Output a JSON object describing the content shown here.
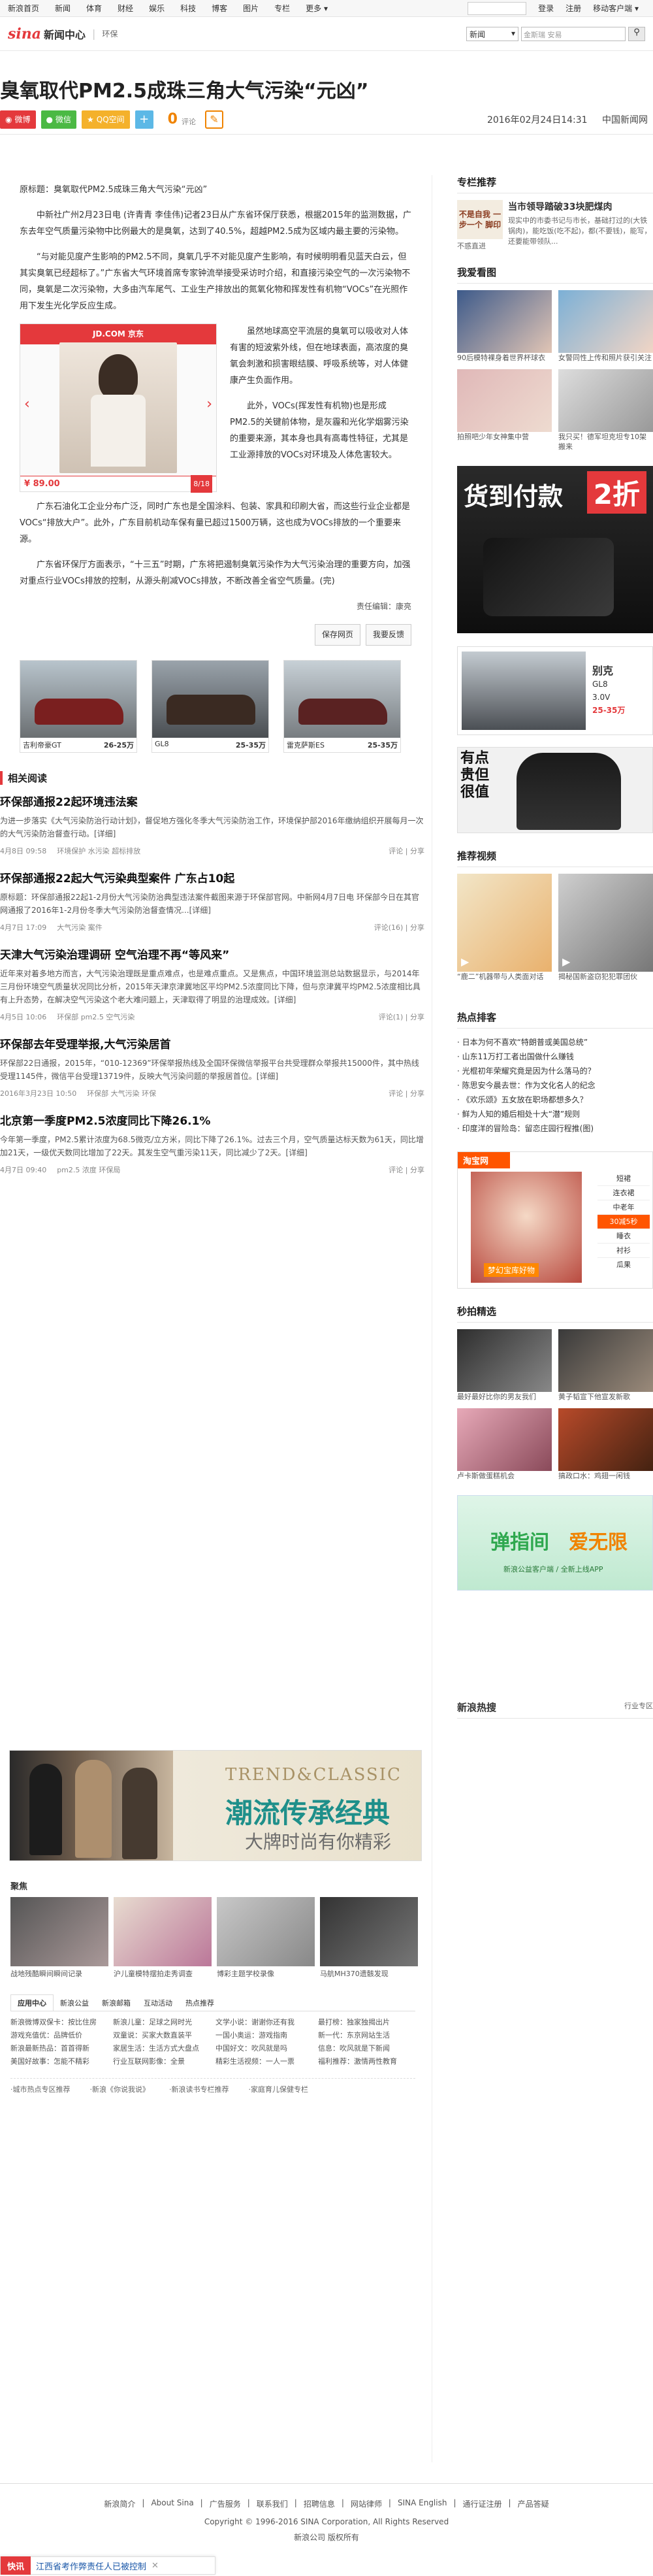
{
  "topnav": {
    "items": [
      "新浪首页",
      "新闻",
      "体育",
      "财经",
      "娱乐",
      "科技",
      "博客",
      "图片",
      "专栏",
      "更多"
    ],
    "search_placeholder": "",
    "login": "登录",
    "register": "注册",
    "mobile": "移动客户端"
  },
  "header": {
    "logo": "sina",
    "logo_sub": "新闻中心",
    "channel": "环保",
    "search_select": "新闻",
    "search_placeholder": "金斯瑞 安易",
    "search_icon": "search-icon"
  },
  "article": {
    "title": "臭氧取代PM2.5成珠三角大气污染“元凶”",
    "share": [
      "微博",
      "微信",
      "QQ空间"
    ],
    "comment_count": "0",
    "comment_label": "评论",
    "datetime": "2016年02月24日14:31",
    "source": "中国新闻网",
    "paragraphs": [
      "原标题：臭氧取代PM2.5成珠三角大气污染“元凶”",
      "中新社广州2月23日电 (许青青 李佳伟)记者23日从广东省环保厅获悉，根据2015年的监测数据，广东去年空气质量污染物中比例最大的是臭氧，达到了40.5%，超越PM2.5成为区域内最主要的污染物。",
      "“与对能见度产生影响的PM2.5不同，臭氧几乎不对能见度产生影响，有时候明明看见蓝天白云，但其实臭氧已经超标了。”广东省大气环境首席专家钟流举接受采访时介绍，和直接污染空气的一次污染物不同，臭氧是二次污染物，大多由汽车尾气、工业生产排放出的氮氧化物和挥发性有机物“VOCs”在光照作用下发生光化学反应生成。",
      "虽然地球高空平流层的臭氧可以吸收对人体有害的短波紫外线，但在地球表面，高浓度的臭氧会刺激和损害眼结膜、呼吸系统等，对人体健康产生负面作用。",
      "此外，VOCs(挥发性有机物)也是形成PM2.5的关键前体物，是灰霾和光化学烟雾污染的重要来源，其本身也具有高毒性特征，尤其是工业源排放的VOCs对环境及人体危害较大。",
      "广东石油化工企业分布广泛，同时广东也是全国涂料、包装、家具和印刷大省，而这些行业企业都是VOCs“排放大户”。此外，广东目前机动车保有量已超过1500万辆，这也成为VOCs排放的一个重要来源。",
      "广东省环保厅方面表示，“十三五”时期，广东将把遏制臭氧污染作为大气污染治理的重要方向，加强对重点行业VOCs排放的控制，从源头削减VOCs排放，不断改善全省空气质量。(完)"
    ],
    "editor_label": "责任编辑：",
    "editor": "康亮",
    "save_btn": "保存网页",
    "report_btn": "我要反馈"
  },
  "gallery": {
    "tag": "JD.COM 京东",
    "price": "¥ 89.00",
    "page": "8/18"
  },
  "car_row": [
    {
      "name": "吉利帝豪GT"
    },
    {
      "name": "GL8"
    },
    {
      "name": "雷克萨斯ES"
    }
  ],
  "car_prices": [
    "26-25万",
    "25-35万",
    "25-35万"
  ],
  "related": {
    "title": "相关阅读",
    "items": [
      {
        "title": "环保部通报22起环境违法案",
        "summary": "为进一步落实《大气污染防治行动计划》，督促地方强化冬季大气污染防治工作，环境保护部2016年缴纳组织开展每月一次的大气污染防治督查行动。[详细]",
        "date": "4月8日 09:58",
        "tags": "环境保护 水污染 超标排放",
        "actions": "评论 | 分享"
      },
      {
        "title": "环保部通报22起大气污染典型案件 广东占10起",
        "summary": "原标题：环保部通报22起1-2月份大气污染防治典型违法案件截图来源于环保部官网。中新网4月7日电 环保部今日在其官网通报了2016年1-2月份冬季大气污染防治督查情况...[详细]",
        "date": "4月7日 17:09",
        "tags": "大气污染 案件",
        "actions": "评论(16) | 分享"
      },
      {
        "title": "天津大气污染治理调研 空气治理不再“等风来”",
        "summary": "近年来对着多地方而言，大气污染治理既是重点难点，也是难点重点。又是焦点，中国环境监测总站数据显示，与2014年三月份环境空气质量状况同比分析，2015年天津京津冀地区平均PM2.5浓度同比下降，但与京津冀平均PM2.5浓度相比具有上升态势，在解决空气污染这个老大难问题上，天津取得了明显的治理成效。[详细]",
        "date": "4月5日 10:06",
        "tags": "环保部 pm2.5 空气污染",
        "actions": "评论(1) | 分享"
      },
      {
        "title": "环保部去年受理举报,大气污染居首",
        "summary": "环保部22日通报，2015年，“010-12369”环保举报热线及全国环保微信举报平台共受理群众举报共15000件，其中热线受理1145件，微信平台受理13719件，反映大气污染问题的举报居首位。[详细]",
        "date": "2016年3月23日 10:50",
        "tags": "环保部 大气污染 环保",
        "actions": "评论 | 分享"
      },
      {
        "title": "北京第一季度PM2.5浓度同比下降26.1%",
        "summary": "今年第一季度，PM2.5累计浓度为68.5微克/立方米，同比下降了26.1%。过去三个月，空气质量达标天数为61天，同比增加21天，一级优天数同比增加了22天。其发生空气重污染11天，同比减少了2天。[详细]",
        "date": "4月7日 09:40",
        "tags": "pm2.5 浓度 环保局",
        "actions": "评论 | 分享"
      }
    ]
  },
  "trend_ad": {
    "line1": "TREND&CLASSIC",
    "line2": "潮流传承经典",
    "line3": "大牌时尚有你精彩"
  },
  "focus": {
    "title": "聚焦",
    "items": [
      "战地残酷瞬间瞬间记录",
      "沪儿童模特摆拍走秀调查",
      "博彩主题学校录像",
      "马航MH370遗骸发现"
    ]
  },
  "tabs": {
    "labels": [
      "应用中心",
      "新浪公益",
      "新浪邮箱",
      "互动活动",
      "热点推荐"
    ],
    "links": [
      [
        "新浪微博双保卡：按比住房",
        "游戏充值优：品牌低价",
        "新浪最新热品：首首得新",
        "美国好故事：怎能不精彩"
      ],
      [
        "新浪儿童：足球之网时光",
        "双童说：买家大数直装平",
        "家居生活：生活方式大盘点",
        "行业互联网影像：全景"
      ],
      [
        "文学小说：谢谢你还有我",
        "一国小奥运：游戏指南",
        "中国好文：吹风就是吗",
        "精彩生活视频：一人一票"
      ],
      [
        "最打榜：独家独揭出片",
        "新一代：东京网站生活",
        "信息：吹风就是下新闻",
        "福利推荐：激情两性教育"
      ]
    ],
    "footer_links": [
      "·城市热点专区推荐",
      "·新浪《你说我说》",
      "·新浪读书专栏推荐",
      "·家庭育儿保健专栏"
    ]
  },
  "sidebar": {
    "recommend_title": "专栏推荐",
    "recommend_item_title": "当市领导踏破33块肥煤肉",
    "recommend_item_desc": "现实中的市委书记与市长，基础打过的(大铁锅肉)，能吃饭(吃不起)，都(不要钱)，能写，还要能带领队...",
    "recommend_img_text": "不是自我 一步一个 脚印",
    "recommend_img_caption": "不惑直进",
    "love_title": "我爱看图",
    "love_items": [
      {
        "caption": "90后模特裸身着世界杯球衣"
      },
      {
        "caption": "女警同性上传和照片获引关注"
      },
      {
        "caption": "拍照吧少年女神集中营"
      },
      {
        "caption": "我只买！德军坦克坦专10架搬来"
      }
    ],
    "pay_ad": {
      "text": "货到付款",
      "discount": "2折"
    },
    "car_ad": {
      "name": "别克",
      "model": "GL8",
      "spec": "3.0V",
      "price": "25-35万"
    },
    "shirt_ad": {
      "text": "有点贵但很值"
    },
    "video_title": "推荐视频",
    "video_items": [
      {
        "caption": "“鹿二”机器带与人类面对话"
      },
      {
        "caption": "揭秘国新盗窃犯犯罪团伙"
      }
    ],
    "hot_title": "热点排客",
    "hot_list": [
      "日本为何不喜欢“特朗普或美国总统”",
      "山东11万打工者出国做什么赚钱",
      "光棍初年荣耀究竟是因为什么落马的？",
      "陈思安今晨去世：作为文化名人的纪念",
      "《欢乐颂》五女放在职场都想多久？",
      "鲜为人知的婚后相处十大“潜”规则",
      "印度洋的冒险岛：留恋庄园行程推(图)"
    ],
    "taobao_title": "淘宝网",
    "taobao_tags": [
      "短裙",
      "连衣裙",
      "中老年",
      "30减5秒",
      "睡衣",
      "衬衫",
      "瓜果"
    ],
    "taobao_banner": "梦幻宝库好物",
    "second_title": "秒拍精选",
    "second_items": [
      {
        "caption": "最好最好比你的男友我们"
      },
      {
        "caption": "黄子韬宣下他宣发新歌"
      },
      {
        "caption": "卢卡斯做蛋糕机会"
      },
      {
        "caption": "搞政口水：鸡翅一闲钱"
      }
    ],
    "app_text1": "弹指间",
    "app_text2": "爱无限",
    "app_sub": "新浪公益客户端 / 全新上线APP",
    "sina_hot_title": "新浪热搜",
    "sina_hot_more": "行业专区"
  },
  "footer": {
    "links": [
      "新浪简介",
      "About Sina",
      "广告服务",
      "联系我们",
      "招聘信息",
      "网站律师",
      "SINA English",
      "通行证注册",
      "产品答疑"
    ],
    "copyright": "Copyright © 1996-2016 SINA Corporation, All Rights Reserved",
    "company": "新浪公司 版权所有"
  },
  "float_bar": {
    "label": "快讯",
    "text": "江西省考作弊责任人已被控制"
  }
}
